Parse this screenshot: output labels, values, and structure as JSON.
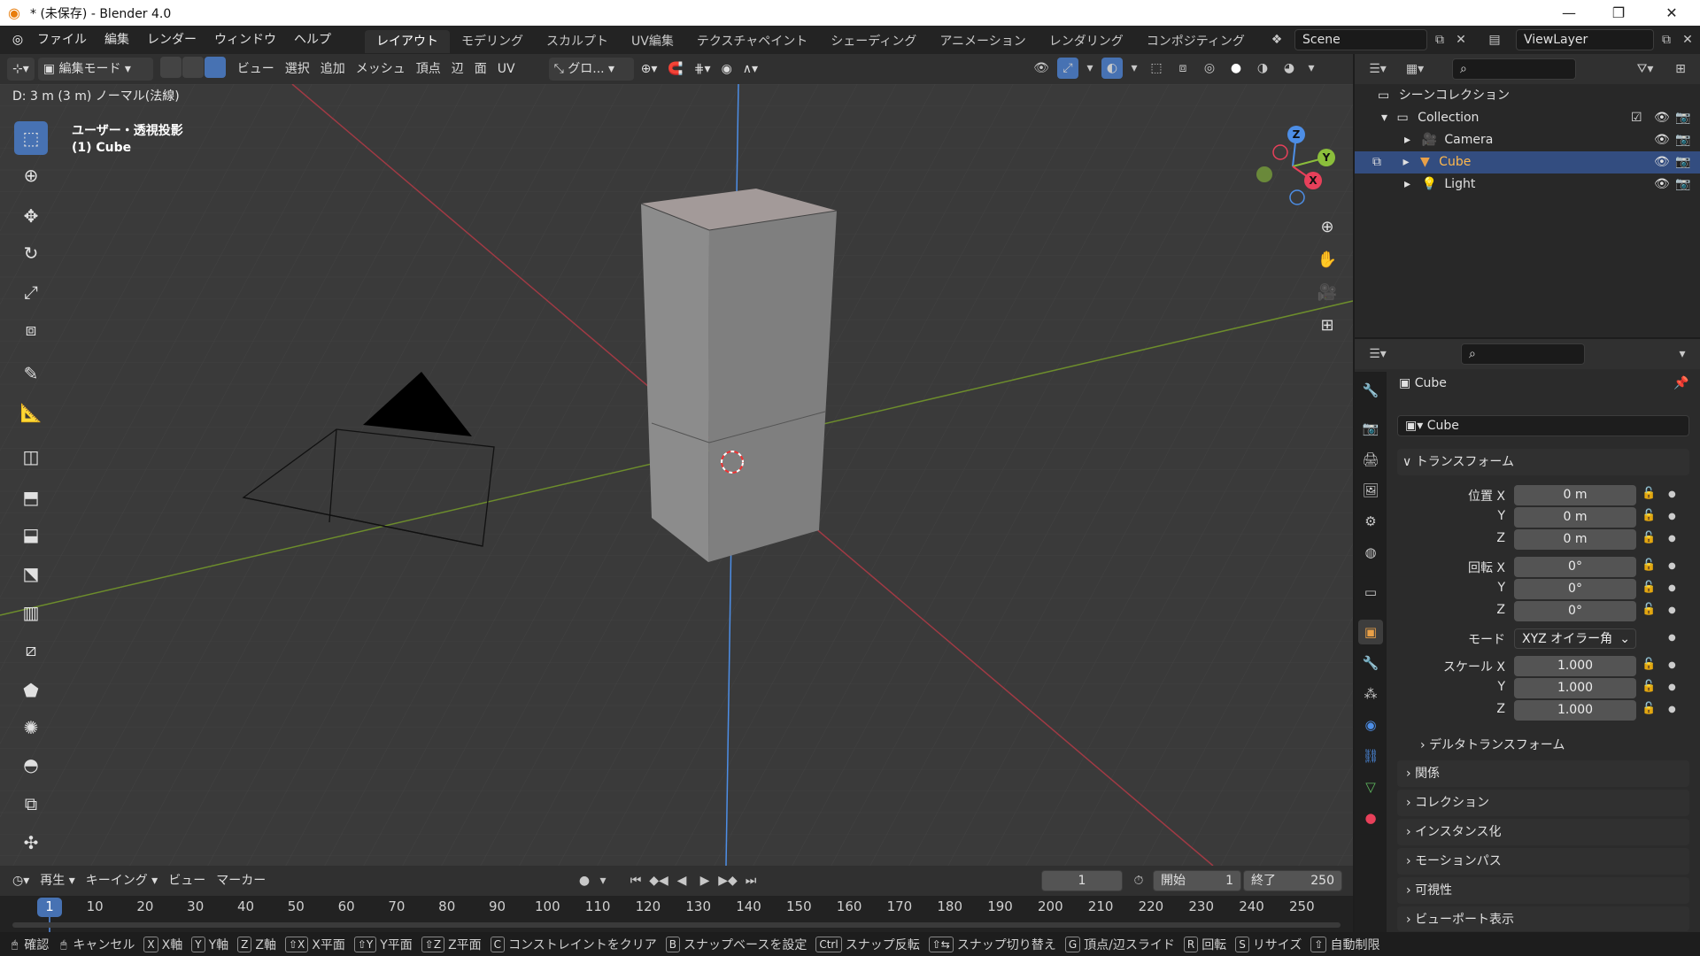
{
  "window": {
    "title": "* (未保存) - Blender 4.0",
    "minimize": "—",
    "maximize": "❐",
    "close": "✕"
  },
  "menubar": {
    "items": [
      "ファイル",
      "編集",
      "レンダー",
      "ウィンドウ",
      "ヘルプ"
    ],
    "workspaces": [
      "レイアウト",
      "モデリング",
      "スカルプト",
      "UV編集",
      "テクスチャペイント",
      "シェーディング",
      "アニメーション",
      "レンダリング",
      "コンポジティング"
    ],
    "scene": "Scene",
    "view_layer": "ViewLayer"
  },
  "viewport_header": {
    "mode": "編集モード",
    "menus": [
      "ビュー",
      "選択",
      "追加",
      "メッシュ",
      "頂点",
      "辺",
      "面",
      "UV"
    ],
    "transform_orientation": "グロ..."
  },
  "status_header": "D: 3 m (3 m) ノーマル(法線)",
  "viewport": {
    "view_name": "ユーザー・透視投影",
    "object_name": "(1) Cube",
    "gizmo": {
      "x": "X",
      "y": "Y",
      "z": "Z"
    }
  },
  "outliner": {
    "root": "シーンコレクション",
    "collection": "Collection",
    "objects": [
      "Camera",
      "Cube",
      "Light"
    ],
    "selected": "Cube"
  },
  "properties": {
    "object_name": "Cube",
    "data_name": "Cube",
    "transform_title": "トランスフォーム",
    "location": {
      "label": "位置 X",
      "x": "0 m",
      "y": "0 m",
      "z": "0 m"
    },
    "rotation": {
      "label": "回転 X",
      "x": "0°",
      "y": "0°",
      "z": "0°"
    },
    "mode_label": "モード",
    "mode_value": "XYZ オイラー角",
    "scale": {
      "label": "スケール X",
      "x": "1.000",
      "y": "1.000",
      "z": "1.000"
    },
    "axis_y": "Y",
    "axis_z": "Z",
    "panels": [
      "デルタトランスフォーム",
      "関係",
      "コレクション",
      "インスタンス化",
      "モーションパス",
      "可視性",
      "ビューポート表示"
    ]
  },
  "timeline": {
    "menus": [
      "再生",
      "キーイング",
      "ビュー",
      "マーカー"
    ],
    "current_frame": "1",
    "start_label": "開始",
    "start": "1",
    "end_label": "終了",
    "end": "250",
    "ticks": [
      "1",
      "10",
      "20",
      "30",
      "40",
      "50",
      "60",
      "70",
      "80",
      "90",
      "100",
      "110",
      "120",
      "130",
      "140",
      "150",
      "160",
      "170",
      "180",
      "190",
      "200",
      "210",
      "220",
      "230",
      "240",
      "250"
    ]
  },
  "statusbar": [
    {
      "key": "",
      "label": "確認"
    },
    {
      "key": "",
      "label": "キャンセル"
    },
    {
      "key": "X",
      "label": "X軸"
    },
    {
      "key": "Y",
      "label": "Y軸"
    },
    {
      "key": "Z",
      "label": "Z軸"
    },
    {
      "key": "⇧X",
      "label": "X平面"
    },
    {
      "key": "⇧Y",
      "label": "Y平面"
    },
    {
      "key": "⇧Z",
      "label": "Z平面"
    },
    {
      "key": "C",
      "label": "コンストレイントをクリア"
    },
    {
      "key": "B",
      "label": "スナップベースを設定"
    },
    {
      "key": "Ctrl",
      "label": "スナップ反転"
    },
    {
      "key": "⇧⇆",
      "label": "スナップ切り替え"
    },
    {
      "key": "G",
      "label": "頂点/辺スライド"
    },
    {
      "key": "R",
      "label": "回転"
    },
    {
      "key": "S",
      "label": "リサイズ"
    },
    {
      "key": "⇧",
      "label": "自動制限"
    }
  ],
  "colors": {
    "accent": "#4772b3",
    "x_axis": "#e8405a",
    "y_axis": "#8bbe3b",
    "z_axis": "#4d8ee6"
  }
}
